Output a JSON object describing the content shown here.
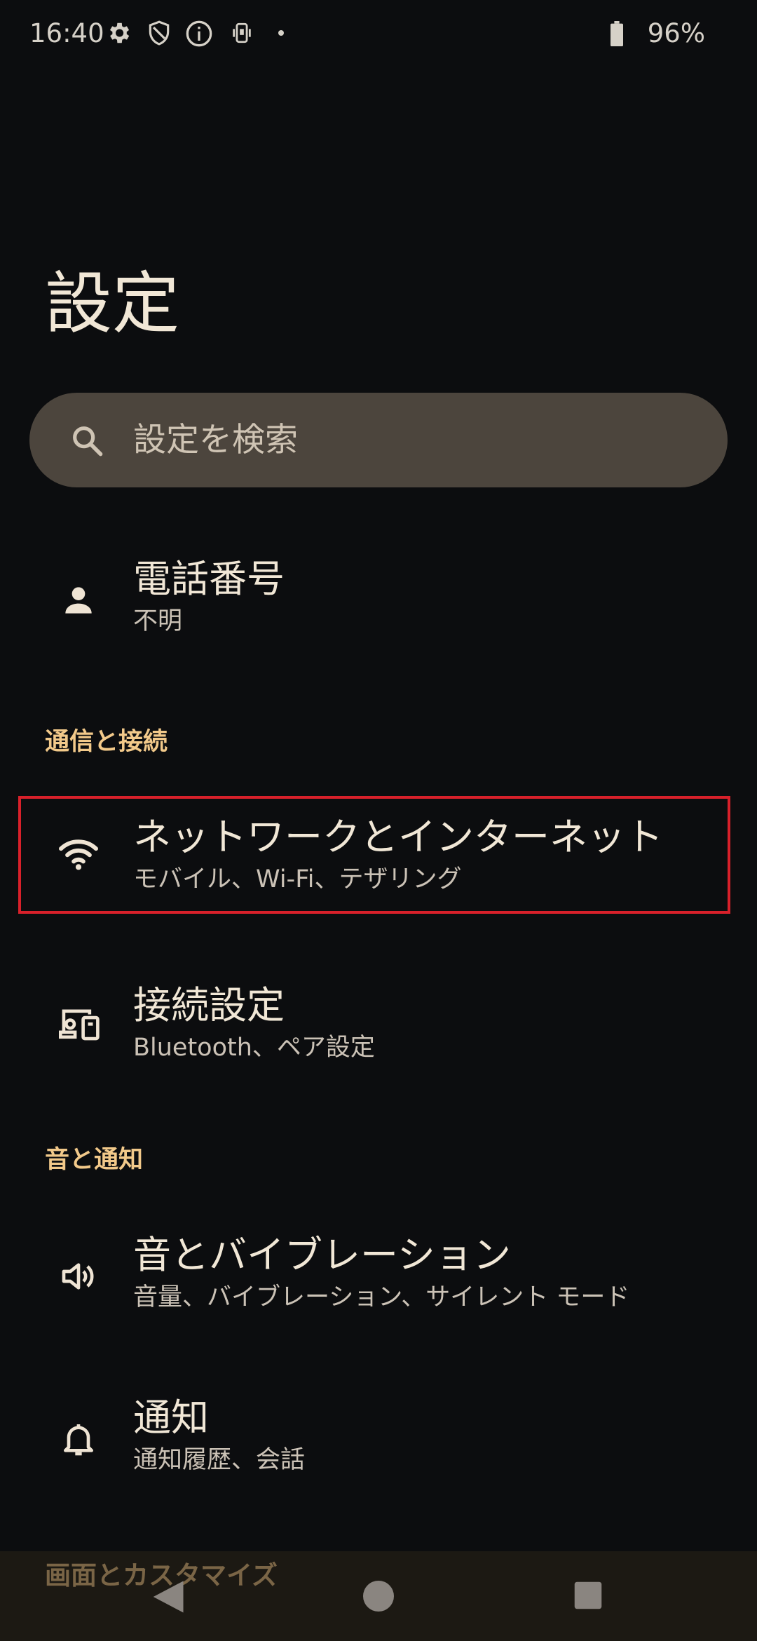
{
  "status_bar": {
    "time": "16:40",
    "icons": [
      "gear-icon",
      "shield-icon",
      "info-icon",
      "phone-vibrate-icon",
      "dot-icon"
    ],
    "battery_percent": "96%"
  },
  "page": {
    "title": "設定"
  },
  "search": {
    "placeholder": "設定を検索"
  },
  "account": {
    "title": "電話番号",
    "subtitle": "不明"
  },
  "sections": [
    {
      "header": "通信と接続",
      "items": [
        {
          "title": "ネットワークとインターネット",
          "subtitle": "モバイル、Wi-Fi、テザリング",
          "icon": "wifi-icon"
        },
        {
          "title": "接続設定",
          "subtitle": "Bluetooth、ペア設定",
          "icon": "devices-icon"
        }
      ]
    },
    {
      "header": "音と通知",
      "items": [
        {
          "title": "音とバイブレーション",
          "subtitle": "音量、バイブレーション、サイレント モード",
          "icon": "volume-icon"
        },
        {
          "title": "通知",
          "subtitle": "通知履歴、会話",
          "icon": "bell-icon"
        }
      ]
    },
    {
      "header": "画面とカスタマイズ"
    }
  ],
  "colors": {
    "background": "#0c0d0f",
    "accent_header": "#f2c98a",
    "search_bg": "#4c453d",
    "highlight_border": "#d8202a"
  }
}
